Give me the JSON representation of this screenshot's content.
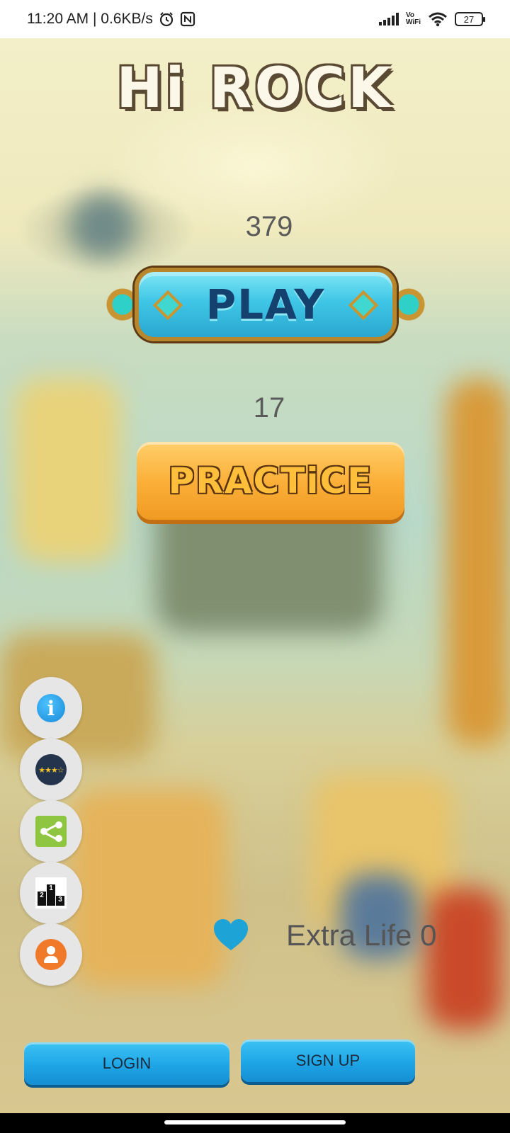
{
  "status_bar": {
    "time_speed": "11:20 AM | 0.6KB/s",
    "vowifi_top": "Vo",
    "vowifi_bottom": "WiFi",
    "battery": "27"
  },
  "app": {
    "title": "Hi ROCK",
    "play_count": "379",
    "play_label": "PLAY",
    "practice_count": "17",
    "practice_label": "PRACTiCE",
    "extra_life": "Extra Life 0",
    "login_label": "LOGIN",
    "signup_label": "SIGN UP"
  },
  "side_buttons": [
    {
      "icon": "info-icon",
      "glyph": "i"
    },
    {
      "icon": "rate-stars-icon",
      "glyph": "★★★☆"
    },
    {
      "icon": "share-icon"
    },
    {
      "icon": "leaderboard-icon",
      "ranks": [
        "2",
        "1",
        "3"
      ]
    },
    {
      "icon": "profile-icon"
    }
  ],
  "colors": {
    "play_button": "#3fc6e6",
    "practice_button": "#fbb03a",
    "auth_buttons": "#1ea5e6",
    "heart": "#1ea3d6"
  }
}
